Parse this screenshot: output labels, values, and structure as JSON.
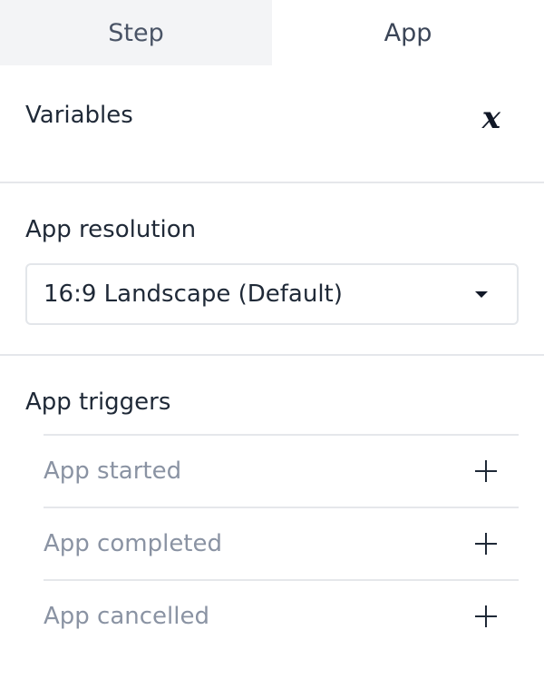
{
  "tabs": [
    {
      "label": "Step",
      "active": false
    },
    {
      "label": "App",
      "active": true
    }
  ],
  "variables": {
    "title": "Variables",
    "icon": "variable-x-icon"
  },
  "resolution": {
    "title": "App resolution",
    "selected": "16:9 Landscape (Default)"
  },
  "triggers": {
    "title": "App triggers",
    "items": [
      {
        "label": "App started"
      },
      {
        "label": "App completed"
      },
      {
        "label": "App cancelled"
      }
    ]
  },
  "colors": {
    "inactive_tab_bg": "#f3f4f6",
    "divider": "#e5e7eb",
    "muted_text": "#8a93a3"
  }
}
